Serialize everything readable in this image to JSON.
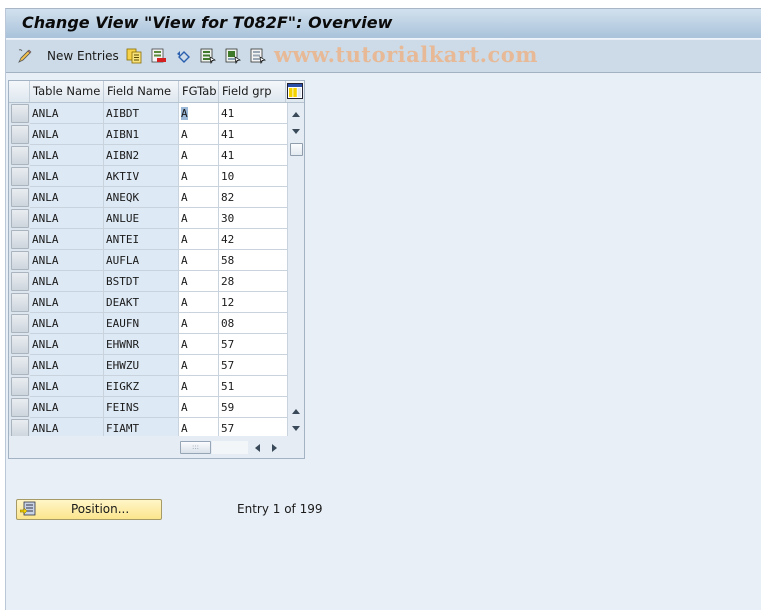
{
  "window": {
    "title": "Change View \"View for T082F\": Overview"
  },
  "toolbar": {
    "new_entries_label": "New Entries",
    "icons": [
      "edit-pencil-icon",
      "copy-as-icon",
      "delete-icon",
      "undo-change-icon",
      "select-all-icon",
      "select-block-icon",
      "deselect-all-icon"
    ],
    "watermark": "www.tutorialkart.com"
  },
  "table": {
    "columns": [
      "Table Name",
      "Field Name",
      "FGTab",
      "Field grp"
    ],
    "config_icon": "table-settings-icon",
    "rows": [
      {
        "table_name": "ANLA",
        "field_name": "AIBDT",
        "fgtab": "A",
        "field_grp": "41"
      },
      {
        "table_name": "ANLA",
        "field_name": "AIBN1",
        "fgtab": "A",
        "field_grp": "41"
      },
      {
        "table_name": "ANLA",
        "field_name": "AIBN2",
        "fgtab": "A",
        "field_grp": "41"
      },
      {
        "table_name": "ANLA",
        "field_name": "AKTIV",
        "fgtab": "A",
        "field_grp": "10"
      },
      {
        "table_name": "ANLA",
        "field_name": "ANEQK",
        "fgtab": "A",
        "field_grp": "82"
      },
      {
        "table_name": "ANLA",
        "field_name": "ANLUE",
        "fgtab": "A",
        "field_grp": "30"
      },
      {
        "table_name": "ANLA",
        "field_name": "ANTEI",
        "fgtab": "A",
        "field_grp": "42"
      },
      {
        "table_name": "ANLA",
        "field_name": "AUFLA",
        "fgtab": "A",
        "field_grp": "58"
      },
      {
        "table_name": "ANLA",
        "field_name": "BSTDT",
        "fgtab": "A",
        "field_grp": "28"
      },
      {
        "table_name": "ANLA",
        "field_name": "DEAKT",
        "fgtab": "A",
        "field_grp": "12"
      },
      {
        "table_name": "ANLA",
        "field_name": "EAUFN",
        "fgtab": "A",
        "field_grp": "08"
      },
      {
        "table_name": "ANLA",
        "field_name": "EHWNR",
        "fgtab": "A",
        "field_grp": "57"
      },
      {
        "table_name": "ANLA",
        "field_name": "EHWZU",
        "fgtab": "A",
        "field_grp": "57"
      },
      {
        "table_name": "ANLA",
        "field_name": "EIGKZ",
        "fgtab": "A",
        "field_grp": "51"
      },
      {
        "table_name": "ANLA",
        "field_name": "FEINS",
        "fgtab": "A",
        "field_grp": "59"
      },
      {
        "table_name": "ANLA",
        "field_name": "FIAMT",
        "fgtab": "A",
        "field_grp": "57"
      }
    ],
    "hscroll_grip": ":::"
  },
  "footer": {
    "position_button_label": "Position...",
    "entry_status": "Entry 1 of 199"
  }
}
